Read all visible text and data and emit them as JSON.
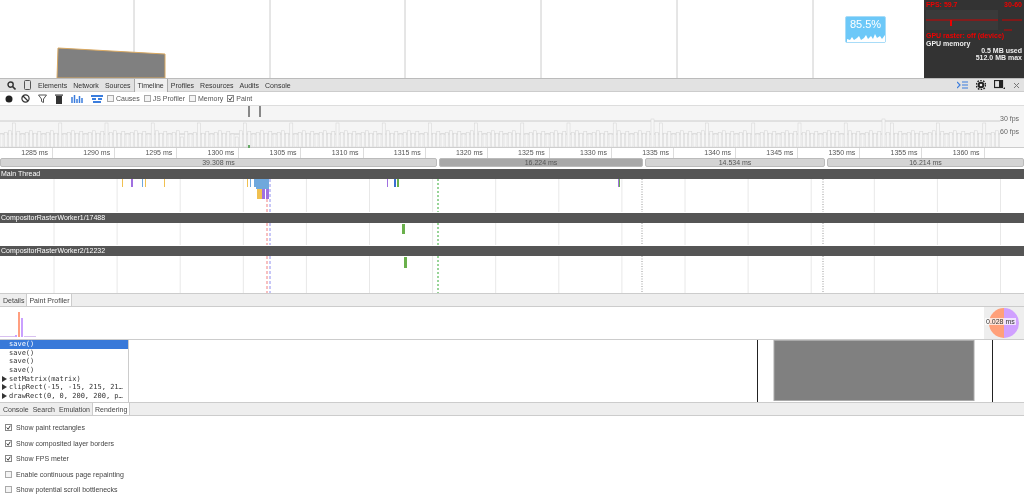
{
  "page": {
    "fps_badge": "85.5%"
  },
  "hud": {
    "fps": "FPS: 59.7",
    "range": "30-60",
    "gpu_raster": "GPU raster: off (device)",
    "memory_title": "GPU memory",
    "used": "0.5 MB used",
    "max": "512.0 MB max"
  },
  "panels": [
    {
      "label": "Elements",
      "selected": false
    },
    {
      "label": "Network",
      "selected": false
    },
    {
      "label": "Sources",
      "selected": false
    },
    {
      "label": "Timeline",
      "selected": true
    },
    {
      "label": "Profiles",
      "selected": false
    },
    {
      "label": "Resources",
      "selected": false
    },
    {
      "label": "Audits",
      "selected": false
    },
    {
      "label": "Console",
      "selected": false
    }
  ],
  "toolbar": {
    "checkboxes": [
      {
        "label": "Causes",
        "checked": false
      },
      {
        "label": "JS Profiler",
        "checked": false
      },
      {
        "label": "Memory",
        "checked": false
      },
      {
        "label": "Paint",
        "checked": true
      }
    ]
  },
  "overview": {
    "fps_labels": [
      "30 fps",
      "60 fps"
    ]
  },
  "ruler": {
    "ticks": [
      "1285 ms",
      "1290 ms",
      "1295 ms",
      "1300 ms",
      "1305 ms",
      "1310 ms",
      "1315 ms",
      "1320 ms",
      "1325 ms",
      "1330 ms",
      "1335 ms",
      "1340 ms",
      "1345 ms",
      "1350 ms",
      "1355 ms",
      "1360 ms"
    ]
  },
  "frames": [
    {
      "label": "39.308 ms",
      "selected": false
    },
    {
      "label": "16.224 ms",
      "selected": true
    },
    {
      "label": "14.534 ms",
      "selected": false
    },
    {
      "label": "16.214 ms",
      "selected": false
    }
  ],
  "threads": [
    {
      "name": "Main Thread"
    },
    {
      "name": "CompositorRasterWorker1/17488"
    },
    {
      "name": "CompositorRasterWorker2/12232"
    }
  ],
  "details_tabs": [
    {
      "label": "Details",
      "selected": false
    },
    {
      "label": "Paint Profiler",
      "selected": true
    }
  ],
  "paint_profiler": {
    "total": "0.028 ms",
    "commands": [
      {
        "text": "save()",
        "selected": true,
        "expandable": false
      },
      {
        "text": "save()",
        "selected": false,
        "expandable": false
      },
      {
        "text": "save()",
        "selected": false,
        "expandable": false
      },
      {
        "text": "save()",
        "selected": false,
        "expandable": false
      },
      {
        "text": "setMatrix(matrix)",
        "selected": false,
        "expandable": true
      },
      {
        "text": "clipRect(-15, -15, 215, 21…",
        "selected": false,
        "expandable": true
      },
      {
        "text": "drawRect(0, 0, 200, 200, p…",
        "selected": false,
        "expandable": true
      }
    ]
  },
  "drawer_tabs": [
    {
      "label": "Console",
      "selected": false
    },
    {
      "label": "Search",
      "selected": false
    },
    {
      "label": "Emulation",
      "selected": false
    },
    {
      "label": "Rendering",
      "selected": true
    }
  ],
  "rendering_options": [
    {
      "label": "Show paint rectangles",
      "checked": true
    },
    {
      "label": "Show composited layer borders",
      "checked": true
    },
    {
      "label": "Show FPS meter",
      "checked": true
    },
    {
      "label": "Enable continuous page repainting",
      "checked": false
    },
    {
      "label": "Show potential scroll bottlenecks",
      "checked": false
    }
  ]
}
